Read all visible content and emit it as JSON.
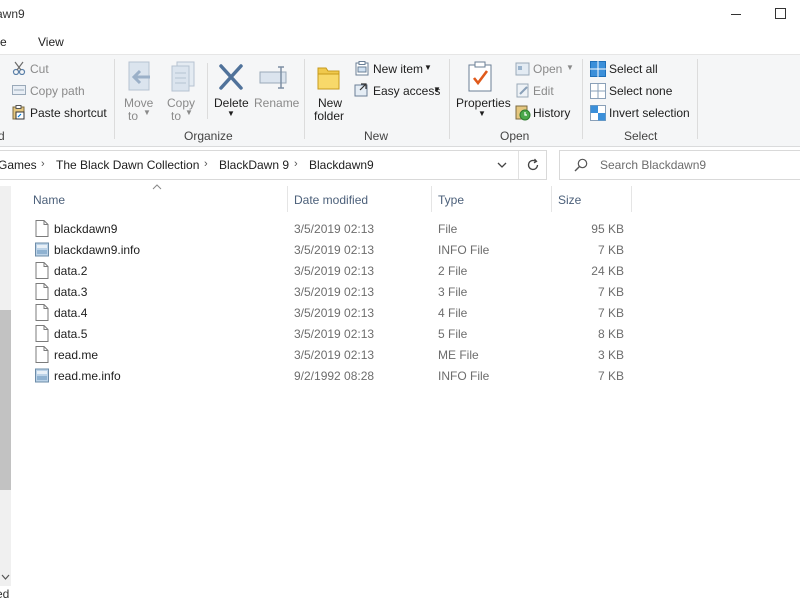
{
  "window": {
    "title": "awn9"
  },
  "menu_tabs": [
    {
      "label": "re"
    },
    {
      "label": "View"
    }
  ],
  "ribbon": {
    "clipboard": {
      "cut": "Cut",
      "copy_path": "Copy path",
      "paste_shortcut": "Paste shortcut",
      "group_label": "d"
    },
    "organize": {
      "move_to": [
        "Move",
        "to"
      ],
      "copy_to": [
        "Copy",
        "to"
      ],
      "delete": "Delete",
      "rename": "Rename",
      "group_label": "Organize"
    },
    "new": {
      "new_folder": [
        "New",
        "folder"
      ],
      "new_item": "New item",
      "easy_access": "Easy access",
      "group_label": "New"
    },
    "open": {
      "properties": "Properties",
      "open": "Open",
      "edit": "Edit",
      "history": "History",
      "group_label": "Open"
    },
    "select": {
      "select_all": "Select all",
      "select_none": "Select none",
      "invert_selection": "Invert selection",
      "group_label": "Select"
    }
  },
  "address": {
    "crumbs": [
      "Games",
      "The Black Dawn Collection",
      "BlackDawn 9",
      "Blackdawn9"
    ]
  },
  "search": {
    "placeholder": "Search Blackdawn9"
  },
  "columns": {
    "name": "Name",
    "date": "Date modified",
    "type": "Type",
    "size": "Size"
  },
  "files": [
    {
      "name": "blackdawn9",
      "date": "3/5/2019 02:13",
      "type": "File",
      "size": "95 KB",
      "icon": "file-icon"
    },
    {
      "name": "blackdawn9.info",
      "date": "3/5/2019 02:13",
      "type": "INFO File",
      "size": "7 KB",
      "icon": "info-file-icon"
    },
    {
      "name": "data.2",
      "date": "3/5/2019 02:13",
      "type": "2 File",
      "size": "24 KB",
      "icon": "file-icon"
    },
    {
      "name": "data.3",
      "date": "3/5/2019 02:13",
      "type": "3 File",
      "size": "7 KB",
      "icon": "file-icon"
    },
    {
      "name": "data.4",
      "date": "3/5/2019 02:13",
      "type": "4 File",
      "size": "7 KB",
      "icon": "file-icon"
    },
    {
      "name": "data.5",
      "date": "3/5/2019 02:13",
      "type": "5 File",
      "size": "8 KB",
      "icon": "file-icon"
    },
    {
      "name": "read.me",
      "date": "3/5/2019 02:13",
      "type": "ME File",
      "size": "3 KB",
      "icon": "file-icon"
    },
    {
      "name": "read.me.info",
      "date": "9/2/1992 08:28",
      "type": "INFO File",
      "size": "7 KB",
      "icon": "info-file-icon"
    }
  ],
  "status": {
    "text": "ed"
  },
  "colors": {
    "accent": "#0078d7",
    "ribbon_bg": "#f5f6f7",
    "header_text": "#4c607a",
    "muted_text": "#6d6d6d"
  }
}
